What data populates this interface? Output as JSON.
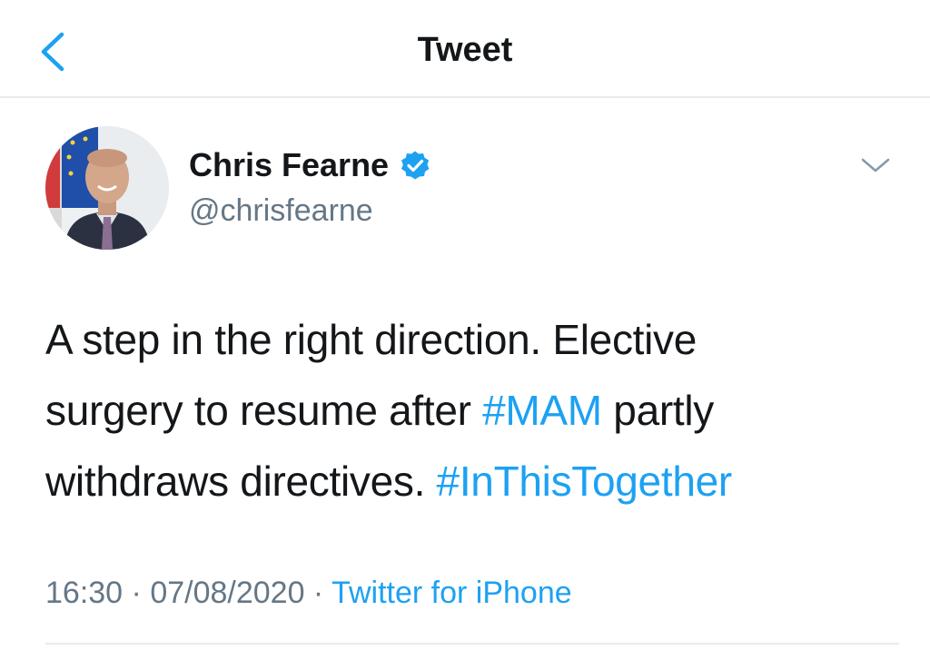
{
  "header": {
    "title": "Tweet",
    "back_icon": "chevron-left-icon"
  },
  "author": {
    "name": "Chris Fearne",
    "handle": "@chrisfearne",
    "verified": true,
    "verified_icon": "verified-badge-icon",
    "menu_icon": "chevron-down-icon"
  },
  "tweet": {
    "line1": "A step in the right direction. Elective",
    "line2_pre": "surgery to resume after ",
    "hashtag1": "#MAM",
    "line2_post": " partly",
    "line3_pre": "withdraws directives. ",
    "hashtag2": "#InThisTogether"
  },
  "meta": {
    "time": "16:30",
    "date": "07/08/2020",
    "source": "Twitter for iPhone"
  },
  "colors": {
    "link": "#1da1f2",
    "text": "#14171a",
    "secondary": "#657786",
    "divider": "#e6ecf0"
  }
}
